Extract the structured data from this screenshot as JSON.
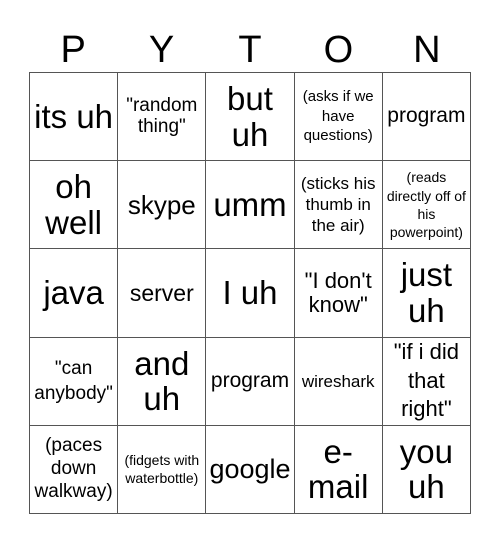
{
  "header": {
    "letters": [
      "P",
      "Y",
      "T",
      "O",
      "N"
    ]
  },
  "board": {
    "rows": [
      [
        "its uh",
        "\"random thing\"",
        "but uh",
        "(asks if we have questions)",
        "program"
      ],
      [
        "oh well",
        "skype",
        "umm",
        "(sticks his thumb in the air)",
        "(reads directly off of his powerpoint)"
      ],
      [
        "java",
        "server",
        "I uh",
        "\"I don't know\"",
        "just uh"
      ],
      [
        "\"can anybody\"",
        "and uh",
        "program",
        "wireshark",
        "\"if i did that right\""
      ],
      [
        "(paces down walkway)",
        "(fidgets with waterbottle)",
        "google",
        "e-mail",
        "you uh"
      ]
    ]
  }
}
